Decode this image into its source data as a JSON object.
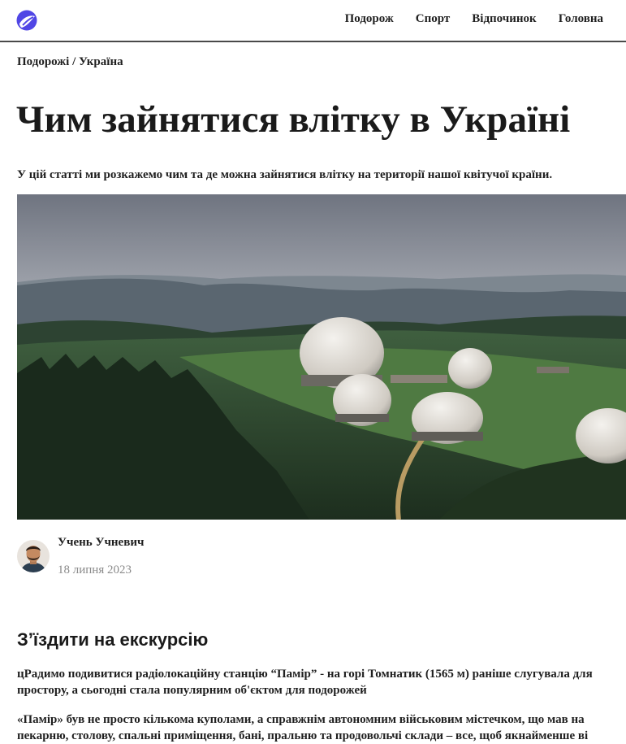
{
  "header": {
    "logo": "site-logo-icon",
    "nav": [
      {
        "label": "Подорож"
      },
      {
        "label": "Спорт"
      },
      {
        "label": "Відпочинок"
      },
      {
        "label": "Головна"
      }
    ]
  },
  "breadcrumb": {
    "section": "Подорожі",
    "separator": " / ",
    "current": "Україна"
  },
  "article": {
    "title": "Чим зайнятися влітку в Україні",
    "lead": "У цій статті ми розкажемо чим та де можна зайнятися влітку на території нашої квітучої країни.",
    "author": {
      "name": "Учень Учневич",
      "date": "18 липня 2023"
    },
    "section_title": "З’їздити на екскурсію",
    "paragraphs": [
      {
        "line1": "цРадимо подивитися радіолокаційну станцію “Памір” - на горі Томнатик (1565 м) раніше слугувала для",
        "line2": "простору, а сьогодні стала популярним об'єктом для подорожей"
      },
      {
        "line1": "«Памір» був не просто кількома куполами, а справжнім автономним військовим містечком, що мав на",
        "line2": "пекарню, столову, спальні приміщення, бані, пральню та продовольчі склади – все, щоб якнайменше ві"
      }
    ]
  },
  "colors": {
    "accent": "#5046e5",
    "text": "#1f1f1f",
    "muted": "#8a8a8a",
    "divider": "#4a4a4a"
  }
}
